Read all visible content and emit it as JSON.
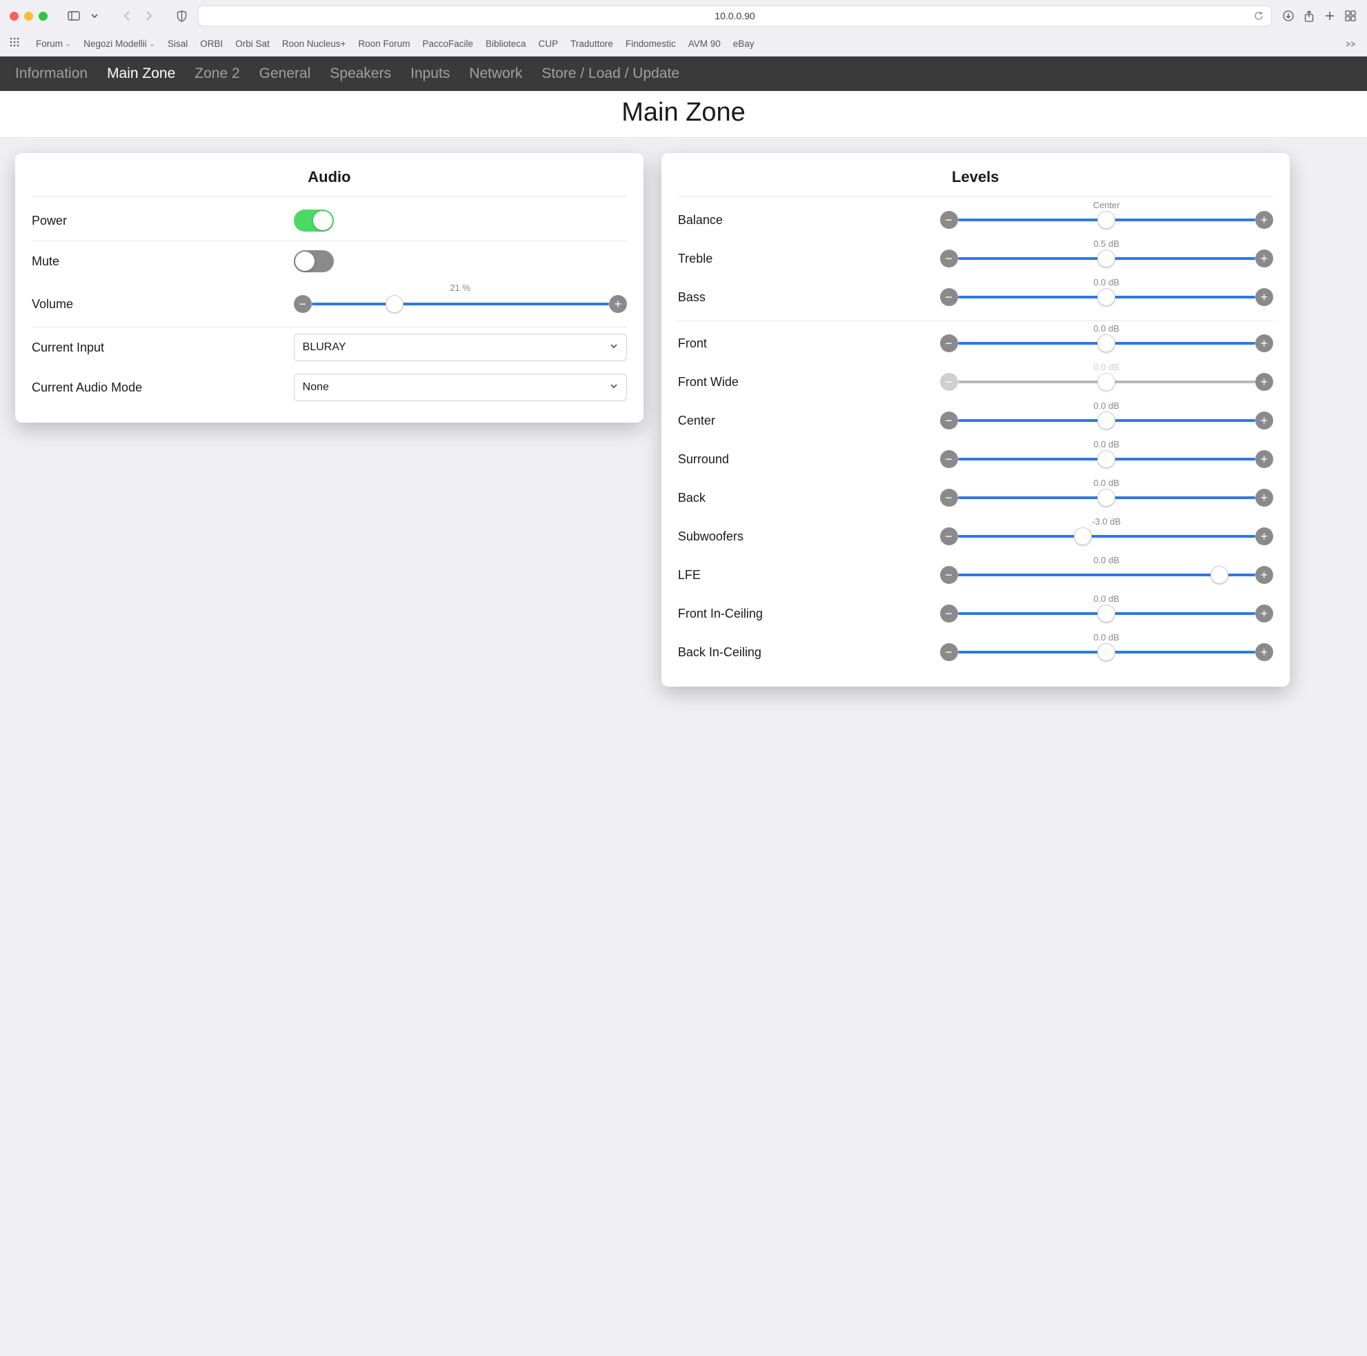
{
  "browser": {
    "url": "10.0.0.90"
  },
  "bookmarks": [
    {
      "label": "Forum",
      "dropdown": true
    },
    {
      "label": "Negozi Modellii",
      "dropdown": true
    },
    {
      "label": "Sisal"
    },
    {
      "label": "ORBI"
    },
    {
      "label": "Orbi Sat"
    },
    {
      "label": "Roon Nucleus+"
    },
    {
      "label": "Roon Forum"
    },
    {
      "label": "PaccoFacile"
    },
    {
      "label": "Biblioteca"
    },
    {
      "label": "CUP"
    },
    {
      "label": "Traduttore"
    },
    {
      "label": "Findomestic"
    },
    {
      "label": "AVM 90"
    },
    {
      "label": "eBay"
    }
  ],
  "nav": {
    "items": [
      "Information",
      "Main Zone",
      "Zone 2",
      "General",
      "Speakers",
      "Inputs",
      "Network",
      "Store / Load / Update"
    ],
    "active": "Main Zone"
  },
  "page": {
    "title": "Main Zone"
  },
  "audio": {
    "title": "Audio",
    "power": {
      "label": "Power",
      "on": true
    },
    "mute": {
      "label": "Mute",
      "on": false
    },
    "volume": {
      "label": "Volume",
      "value_text": "21 %",
      "pos": 28
    },
    "current_input": {
      "label": "Current Input",
      "value": "BLURAY"
    },
    "current_audio_mode": {
      "label": "Current Audio Mode",
      "value": "None"
    }
  },
  "levels": {
    "title": "Levels",
    "top": [
      {
        "key": "balance",
        "label": "Balance",
        "value_text": "Center",
        "pos": 50,
        "disabled": false
      },
      {
        "key": "treble",
        "label": "Treble",
        "value_text": "0.5 dB",
        "pos": 50,
        "disabled": false
      },
      {
        "key": "bass",
        "label": "Bass",
        "value_text": "0.0 dB",
        "pos": 50,
        "disabled": false
      }
    ],
    "channels": [
      {
        "key": "front",
        "label": "Front",
        "value_text": "0.0 dB",
        "pos": 50,
        "disabled": false
      },
      {
        "key": "front-wide",
        "label": "Front Wide",
        "value_text": "0.0 dB",
        "pos": 50,
        "disabled": true
      },
      {
        "key": "center",
        "label": "Center",
        "value_text": "0.0 dB",
        "pos": 50,
        "disabled": false
      },
      {
        "key": "surround",
        "label": "Surround",
        "value_text": "0.0 dB",
        "pos": 50,
        "disabled": false
      },
      {
        "key": "back",
        "label": "Back",
        "value_text": "0.0 dB",
        "pos": 50,
        "disabled": false
      },
      {
        "key": "subwoofers",
        "label": "Subwoofers",
        "value_text": "-3.0 dB",
        "pos": 42,
        "disabled": false
      },
      {
        "key": "lfe",
        "label": "LFE",
        "value_text": "0.0 dB",
        "pos": 88,
        "disabled": false
      },
      {
        "key": "front-in-ceiling",
        "label": "Front In-Ceiling",
        "value_text": "0.0 dB",
        "pos": 50,
        "disabled": false
      },
      {
        "key": "back-in-ceiling",
        "label": "Back In-Ceiling",
        "value_text": "0.0 dB",
        "pos": 50,
        "disabled": false
      }
    ]
  }
}
